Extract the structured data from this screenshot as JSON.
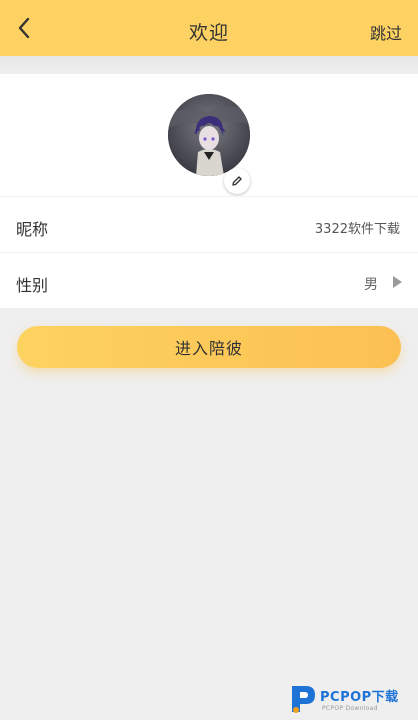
{
  "header": {
    "title": "欢迎",
    "skip_label": "跳过",
    "back_icon": "chevron-left-icon",
    "background": "#fdd262"
  },
  "profile": {
    "avatar_alt": "avatar",
    "edit_icon": "pencil-icon",
    "nickname_label": "昵称",
    "nickname_value": "3322软件下载",
    "gender_label": "性别",
    "gender_value": "男",
    "gender_arrow_icon": "triangle-right-icon"
  },
  "primary_button": {
    "label": "进入陪彼",
    "accent": "#fdc75a"
  },
  "watermark": {
    "brand": "PCPOP下载",
    "sub": "PCPOP Download"
  }
}
